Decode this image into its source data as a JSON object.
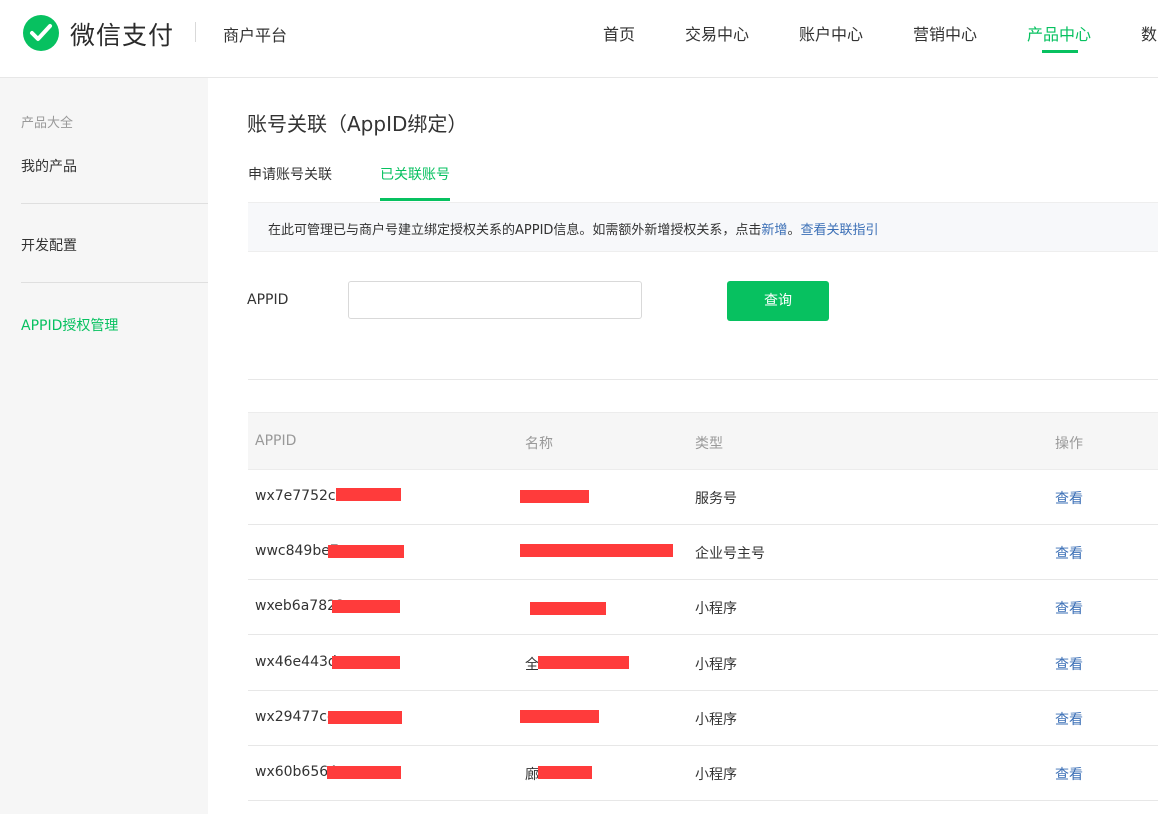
{
  "header": {
    "brand": "微信支付",
    "platform": "商户平台",
    "nav": [
      "首页",
      "交易中心",
      "账户中心",
      "营销中心",
      "产品中心",
      "数"
    ],
    "active_nav": "产品中心"
  },
  "sidebar": {
    "group_title": "产品大全",
    "items": [
      "我的产品",
      "开发配置",
      "APPID授权管理"
    ],
    "active_item": "APPID授权管理"
  },
  "main": {
    "title": "账号关联（AppID绑定）",
    "tabs": [
      "申请账号关联",
      "已关联账号"
    ],
    "active_tab": "已关联账号",
    "notice": {
      "text_before": "在此可管理已与商户号建立绑定授权关系的APPID信息。如需额外新增授权关系，点击",
      "link_add": "新增",
      "text_after": "。",
      "link_guide": "查看关联指引"
    },
    "filter": {
      "label": "APPID",
      "value": "",
      "placeholder": ""
    },
    "query_button": "查询"
  },
  "table": {
    "columns": [
      "APPID",
      "名称",
      "类型",
      "操作"
    ],
    "rows": [
      {
        "appid": "wx7e7752cc",
        "name": "",
        "type": "服务号",
        "action": "查看"
      },
      {
        "appid": "wwc849be7",
        "name": "",
        "type": "企业号主号",
        "action": "查看"
      },
      {
        "appid": "wxeb6a7822",
        "name": "",
        "type": "小程序",
        "action": "查看"
      },
      {
        "appid": "wx46e443d",
        "name": "全",
        "type": "小程序",
        "action": "查看"
      },
      {
        "appid": "wx29477ce",
        "name": "",
        "type": "小程序",
        "action": "查看"
      },
      {
        "appid": "wx60b6564",
        "name": "廊",
        "type": "小程序",
        "action": "查看"
      }
    ]
  },
  "colors": {
    "accent": "#07c160",
    "link": "#3b6fb6",
    "redaction": "#ff3b3b"
  },
  "icons": {
    "logo": "wechat-pay-logo-icon"
  }
}
